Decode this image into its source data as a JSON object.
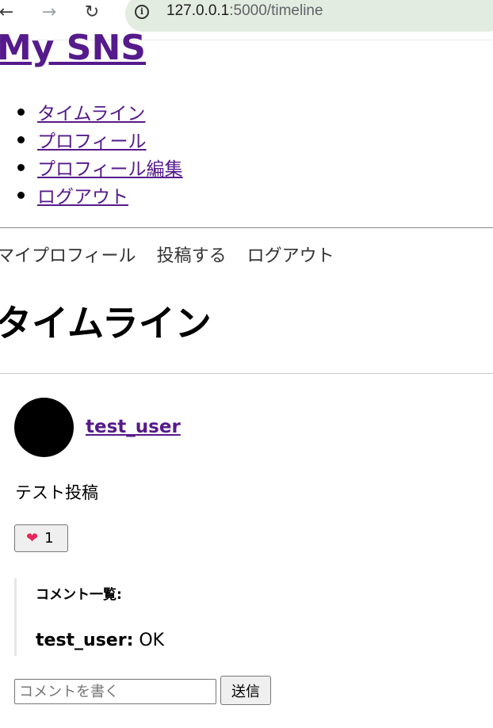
{
  "browser": {
    "url_host": "127.0.0.1",
    "url_path": ":5000/timeline"
  },
  "site": {
    "title": "My SNS"
  },
  "menu": {
    "items": [
      {
        "label": "タイムライン"
      },
      {
        "label": "プロフィール"
      },
      {
        "label": "プロフィール編集"
      },
      {
        "label": "ログアウト"
      }
    ]
  },
  "topnav": {
    "items": [
      {
        "label": "マイプロフィール"
      },
      {
        "label": "投稿する"
      },
      {
        "label": "ログアウト"
      }
    ]
  },
  "page": {
    "heading": "タイムライン"
  },
  "post": {
    "username": "test_user",
    "text": "テスト投稿",
    "likes": "1",
    "comments_title": "コメント一覧:",
    "comments": [
      {
        "author": "test_user:",
        "text": " OK"
      }
    ],
    "comment_placeholder": "コメントを書く",
    "send_label": "送信"
  },
  "colors": {
    "link": "#551a8b",
    "heart": "#e8265e"
  }
}
